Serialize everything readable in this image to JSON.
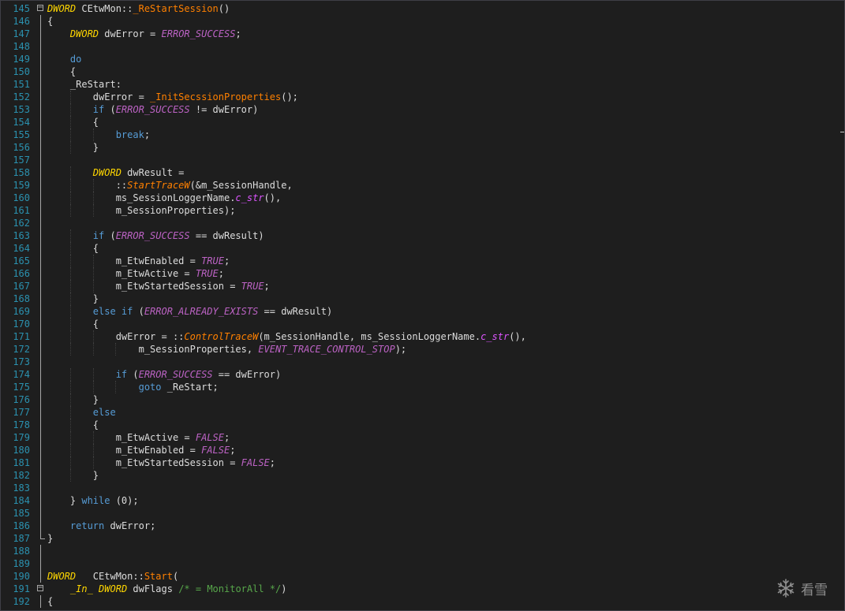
{
  "editor": {
    "colors": {
      "background": "#1e1e1e",
      "line_number": "#2b91af",
      "keyword": "#569cd6",
      "type": "#ffd700",
      "macro": "#bd63c5",
      "function": "#ff8000",
      "member": "#dd55ff",
      "comment": "#57a64a",
      "text": "#dcdcdc"
    },
    "lines": [
      {
        "n": "145",
        "fold": "minus",
        "tokens": [
          {
            "c": "type",
            "v": "DWORD"
          },
          {
            "c": "plain",
            "v": " CEtwMon::"
          },
          {
            "c": "fn",
            "v": "_ReStartSession"
          },
          {
            "c": "plain",
            "v": "()"
          }
        ]
      },
      {
        "n": "146",
        "tokens": [
          {
            "c": "plain",
            "v": "{"
          }
        ]
      },
      {
        "n": "147",
        "tokens": [
          {
            "c": "plain",
            "v": "    "
          },
          {
            "c": "type",
            "v": "DWORD"
          },
          {
            "c": "plain",
            "v": " dwError = "
          },
          {
            "c": "mac",
            "v": "ERROR_SUCCESS"
          },
          {
            "c": "plain",
            "v": ";"
          }
        ]
      },
      {
        "n": "148",
        "tokens": []
      },
      {
        "n": "149",
        "tokens": [
          {
            "c": "plain",
            "v": "    "
          },
          {
            "c": "kw",
            "v": "do"
          }
        ]
      },
      {
        "n": "150",
        "tokens": [
          {
            "c": "plain",
            "v": "    {"
          }
        ]
      },
      {
        "n": "151",
        "tokens": [
          {
            "c": "plain",
            "v": "    _ReStart:"
          }
        ]
      },
      {
        "n": "152",
        "tokens": [
          {
            "c": "plain",
            "v": "        dwError = "
          },
          {
            "c": "fn",
            "v": "_InitSecssionProperties"
          },
          {
            "c": "plain",
            "v": "();"
          }
        ]
      },
      {
        "n": "153",
        "tokens": [
          {
            "c": "plain",
            "v": "        "
          },
          {
            "c": "kw",
            "v": "if"
          },
          {
            "c": "plain",
            "v": " ("
          },
          {
            "c": "mac",
            "v": "ERROR_SUCCESS"
          },
          {
            "c": "plain",
            "v": " != dwError)"
          }
        ]
      },
      {
        "n": "154",
        "tokens": [
          {
            "c": "plain",
            "v": "        {"
          }
        ]
      },
      {
        "n": "155",
        "tokens": [
          {
            "c": "plain",
            "v": "            "
          },
          {
            "c": "kw",
            "v": "break"
          },
          {
            "c": "plain",
            "v": ";"
          }
        ]
      },
      {
        "n": "156",
        "tokens": [
          {
            "c": "plain",
            "v": "        }"
          }
        ]
      },
      {
        "n": "157",
        "tokens": []
      },
      {
        "n": "158",
        "tokens": [
          {
            "c": "plain",
            "v": "        "
          },
          {
            "c": "type",
            "v": "DWORD"
          },
          {
            "c": "plain",
            "v": " dwResult ="
          }
        ]
      },
      {
        "n": "159",
        "tokens": [
          {
            "c": "plain",
            "v": "            ::"
          },
          {
            "c": "fni",
            "v": "StartTraceW"
          },
          {
            "c": "plain",
            "v": "(&m_SessionHandle,"
          }
        ]
      },
      {
        "n": "160",
        "tokens": [
          {
            "c": "plain",
            "v": "            ms_SessionLoggerName."
          },
          {
            "c": "mem",
            "v": "c_str"
          },
          {
            "c": "plain",
            "v": "(),"
          }
        ]
      },
      {
        "n": "161",
        "tokens": [
          {
            "c": "plain",
            "v": "            m_SessionProperties);"
          }
        ]
      },
      {
        "n": "162",
        "tokens": []
      },
      {
        "n": "163",
        "tokens": [
          {
            "c": "plain",
            "v": "        "
          },
          {
            "c": "kw",
            "v": "if"
          },
          {
            "c": "plain",
            "v": " ("
          },
          {
            "c": "mac",
            "v": "ERROR_SUCCESS"
          },
          {
            "c": "plain",
            "v": " == dwResult)"
          }
        ]
      },
      {
        "n": "164",
        "tokens": [
          {
            "c": "plain",
            "v": "        {"
          }
        ]
      },
      {
        "n": "165",
        "tokens": [
          {
            "c": "plain",
            "v": "            m_EtwEnabled = "
          },
          {
            "c": "mac",
            "v": "TRUE"
          },
          {
            "c": "plain",
            "v": ";"
          }
        ]
      },
      {
        "n": "166",
        "tokens": [
          {
            "c": "plain",
            "v": "            m_EtwActive = "
          },
          {
            "c": "mac",
            "v": "TRUE"
          },
          {
            "c": "plain",
            "v": ";"
          }
        ]
      },
      {
        "n": "167",
        "tokens": [
          {
            "c": "plain",
            "v": "            m_EtwStartedSession = "
          },
          {
            "c": "mac",
            "v": "TRUE"
          },
          {
            "c": "plain",
            "v": ";"
          }
        ]
      },
      {
        "n": "168",
        "tokens": [
          {
            "c": "plain",
            "v": "        }"
          }
        ]
      },
      {
        "n": "169",
        "tokens": [
          {
            "c": "plain",
            "v": "        "
          },
          {
            "c": "kw",
            "v": "else if"
          },
          {
            "c": "plain",
            "v": " ("
          },
          {
            "c": "mac",
            "v": "ERROR_ALREADY_EXISTS"
          },
          {
            "c": "plain",
            "v": " == dwResult)"
          }
        ]
      },
      {
        "n": "170",
        "tokens": [
          {
            "c": "plain",
            "v": "        {"
          }
        ]
      },
      {
        "n": "171",
        "tokens": [
          {
            "c": "plain",
            "v": "            dwError = ::"
          },
          {
            "c": "fni",
            "v": "ControlTraceW"
          },
          {
            "c": "plain",
            "v": "(m_SessionHandle, ms_SessionLoggerName."
          },
          {
            "c": "mem",
            "v": "c_str"
          },
          {
            "c": "plain",
            "v": "(),"
          }
        ]
      },
      {
        "n": "172",
        "tokens": [
          {
            "c": "plain",
            "v": "                m_SessionProperties, "
          },
          {
            "c": "mac",
            "v": "EVENT_TRACE_CONTROL_STOP"
          },
          {
            "c": "plain",
            "v": ");"
          }
        ]
      },
      {
        "n": "173",
        "tokens": []
      },
      {
        "n": "174",
        "tokens": [
          {
            "c": "plain",
            "v": "            "
          },
          {
            "c": "kw",
            "v": "if"
          },
          {
            "c": "plain",
            "v": " ("
          },
          {
            "c": "mac",
            "v": "ERROR_SUCCESS"
          },
          {
            "c": "plain",
            "v": " == dwError)"
          }
        ]
      },
      {
        "n": "175",
        "tokens": [
          {
            "c": "plain",
            "v": "                "
          },
          {
            "c": "kw",
            "v": "goto"
          },
          {
            "c": "plain",
            "v": " _ReStart;"
          }
        ]
      },
      {
        "n": "176",
        "tokens": [
          {
            "c": "plain",
            "v": "        }"
          }
        ]
      },
      {
        "n": "177",
        "tokens": [
          {
            "c": "plain",
            "v": "        "
          },
          {
            "c": "kw",
            "v": "else"
          }
        ]
      },
      {
        "n": "178",
        "tokens": [
          {
            "c": "plain",
            "v": "        {"
          }
        ]
      },
      {
        "n": "179",
        "tokens": [
          {
            "c": "plain",
            "v": "            m_EtwActive = "
          },
          {
            "c": "mac",
            "v": "FALSE"
          },
          {
            "c": "plain",
            "v": ";"
          }
        ]
      },
      {
        "n": "180",
        "tokens": [
          {
            "c": "plain",
            "v": "            m_EtwEnabled = "
          },
          {
            "c": "mac",
            "v": "FALSE"
          },
          {
            "c": "plain",
            "v": ";"
          }
        ]
      },
      {
        "n": "181",
        "tokens": [
          {
            "c": "plain",
            "v": "            m_EtwStartedSession = "
          },
          {
            "c": "mac",
            "v": "FALSE"
          },
          {
            "c": "plain",
            "v": ";"
          }
        ]
      },
      {
        "n": "182",
        "tokens": [
          {
            "c": "plain",
            "v": "        }"
          }
        ]
      },
      {
        "n": "183",
        "tokens": []
      },
      {
        "n": "184",
        "tokens": [
          {
            "c": "plain",
            "v": "    } "
          },
          {
            "c": "kw",
            "v": "while"
          },
          {
            "c": "plain",
            "v": " (0);"
          }
        ]
      },
      {
        "n": "185",
        "tokens": []
      },
      {
        "n": "186",
        "tokens": [
          {
            "c": "plain",
            "v": "    "
          },
          {
            "c": "kw",
            "v": "return"
          },
          {
            "c": "plain",
            "v": " dwError;"
          }
        ]
      },
      {
        "n": "187",
        "tokens": [
          {
            "c": "plain",
            "v": "}"
          }
        ],
        "gutter": "end"
      },
      {
        "n": "188",
        "tokens": []
      },
      {
        "n": "189",
        "tokens": []
      },
      {
        "n": "190",
        "tokens": [
          {
            "c": "type",
            "v": "DWORD"
          },
          {
            "c": "plain",
            "v": "   CEtwMon::"
          },
          {
            "c": "fn",
            "v": "Start"
          },
          {
            "c": "plain",
            "v": "("
          }
        ]
      },
      {
        "n": "191",
        "fold": "minus",
        "tokens": [
          {
            "c": "plain",
            "v": "    "
          },
          {
            "c": "ann",
            "v": "_In_"
          },
          {
            "c": "plain",
            "v": " "
          },
          {
            "c": "type",
            "v": "DWORD"
          },
          {
            "c": "plain",
            "v": " dwFlags "
          },
          {
            "c": "cmt",
            "v": "/* = MonitorAll */"
          },
          {
            "c": "plain",
            "v": ")"
          }
        ]
      },
      {
        "n": "192",
        "tokens": [
          {
            "c": "plain",
            "v": "{"
          }
        ]
      }
    ]
  },
  "watermark": {
    "icon": "snowflake-icon",
    "text": "看雪"
  }
}
